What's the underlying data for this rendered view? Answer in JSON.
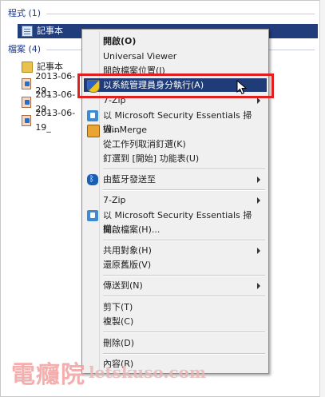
{
  "sections": {
    "programs": "程式 (1)",
    "files": "檔案 (4)"
  },
  "results": {
    "program_item": "記事本",
    "file_items": [
      {
        "label": "記事本",
        "icon": "folder-icon"
      },
      {
        "label": "2013-06-29_",
        "icon": "media-file-icon"
      },
      {
        "label": "2013-06-29_",
        "icon": "media-file-icon"
      },
      {
        "label": "2013-06-19_",
        "icon": "media-file-icon"
      }
    ]
  },
  "context_menu": {
    "open": "開啟(O)",
    "universal_viewer": "Universal Viewer",
    "open_location": "開啟檔案位置(I)",
    "run_as_admin": "以系統管理員身分執行(A)",
    "seven_zip_1": "7-Zip",
    "mse_scan_1": "以 Microsoft Security Essentials 掃描...",
    "winmerge": "WinMerge",
    "unpin_taskbar": "從工作列取消釘選(K)",
    "pin_start": "釘選到 [開始] 功能表(U)",
    "bluetooth_send": "由藍牙發送至",
    "seven_zip_2": "7-Zip",
    "mse_scan_2": "以 Microsoft Security Essentials 掃描...",
    "open_file": "開啟檔案(H)...",
    "share_with": "共用對象(H)",
    "restore_versions": "還原舊版(V)",
    "send_to": "傳送到(N)",
    "cut": "剪下(T)",
    "copy": "複製(C)",
    "delete": "刪除(D)",
    "properties": "內容(R)"
  },
  "watermark": {
    "brand": "電癮院",
    "domain": "letskuso.com"
  },
  "colors": {
    "highlight": "#213d7c",
    "callout_border": "#e21f1f"
  }
}
